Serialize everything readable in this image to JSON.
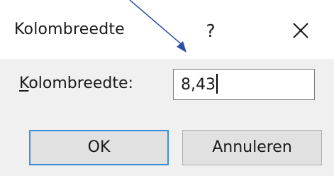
{
  "dialog": {
    "title": "Kolombreedte",
    "help_label": "?",
    "close_icon": "close-icon"
  },
  "form": {
    "label_mnemonic": "K",
    "label_rest": "olombreedte:",
    "value": "8,43"
  },
  "buttons": {
    "ok_label": "OK",
    "cancel_label": "Annuleren"
  },
  "colors": {
    "default_button_border": "#3c8fdb",
    "annotation_arrow": "#2b4fa8"
  }
}
